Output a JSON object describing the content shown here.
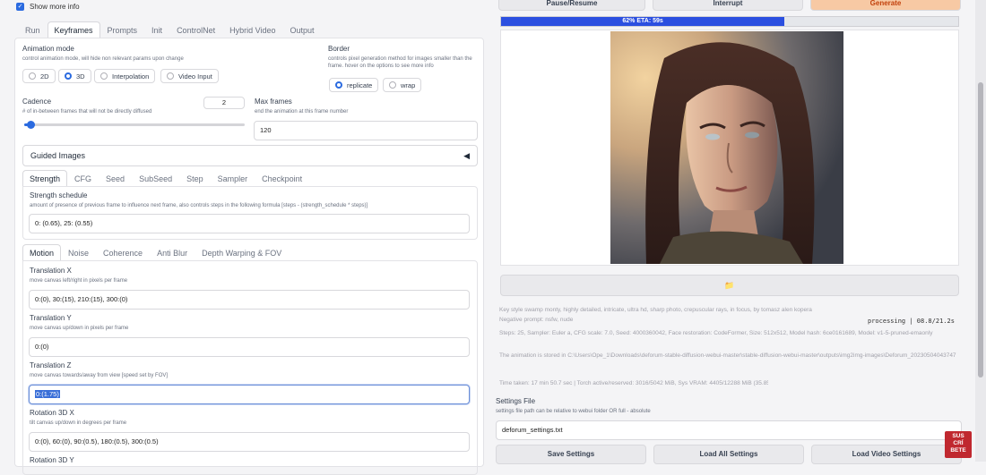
{
  "show_more_info": "Show more info",
  "main_tabs": [
    "Run",
    "Keyframes",
    "Prompts",
    "Init",
    "ControlNet",
    "Hybrid Video",
    "Output"
  ],
  "animation_mode": {
    "label": "Animation mode",
    "hint": "control animation mode, will hide non relevant params upon change",
    "options": [
      "2D",
      "3D",
      "Interpolation",
      "Video Input"
    ],
    "selected": "3D"
  },
  "border": {
    "label": "Border",
    "hint": "controls pixel generation method for images smaller than the frame. hover on the options to see more info",
    "options": [
      "replicate",
      "wrap"
    ],
    "selected": "replicate"
  },
  "cadence": {
    "label": "Cadence",
    "hint": "# of in-between frames that will not be directly diffused",
    "value": "2",
    "slider_fraction": 0.03
  },
  "max_frames": {
    "label": "Max frames",
    "hint": "end the animation at this frame number",
    "value": "120"
  },
  "guided_images": {
    "label": "Guided Images",
    "arrow": "◀"
  },
  "schedule_tabs": [
    "Strength",
    "CFG",
    "Seed",
    "SubSeed",
    "Step",
    "Sampler",
    "Checkpoint"
  ],
  "strength_schedule": {
    "label": "Strength schedule",
    "hint": "amount of presence of previous frame to influence next frame, also controls steps in the following formula [steps - (strength_schedule * steps)]",
    "value": "0: (0.65), 25: (0.55)"
  },
  "motion_tabs": [
    "Motion",
    "Noise",
    "Coherence",
    "Anti Blur",
    "Depth Warping & FOV"
  ],
  "translation_x": {
    "label": "Translation X",
    "hint": "move canvas left/right in pixels per frame",
    "value": "0:(0), 30:(15), 210:(15), 300:(0)"
  },
  "translation_y": {
    "label": "Translation Y",
    "hint": "move canvas up/down in pixels per frame",
    "value": "0:(0)"
  },
  "translation_z": {
    "label": "Translation Z",
    "hint": "move canvas towards/away from view [speed set by FOV]",
    "value": "0:(1.75)"
  },
  "rotation_3d_x": {
    "label": "Rotation 3D X",
    "hint": "tilt canvas up/down in degrees per frame",
    "value": "0:(0), 60:(0), 90:(0.5), 180:(0.5), 300:(0.5)"
  },
  "rotation_3d_y": {
    "label": "Rotation 3D Y"
  },
  "top_buttons": [
    "Pause/Resume",
    "Interrupt",
    "Generate"
  ],
  "progress": {
    "text": "62% ETA: 59s",
    "fraction": 0.62
  },
  "folder_icon": "📁",
  "info": {
    "prompt": "Key style swamp monty, highly detailed, intricate, ultra hd, sharp photo, crepuscular rays, in focus, by tomasz alen kopera",
    "negative": "Negative prompt: nsfw, nude",
    "processing": "processing | 08.8/21.2s",
    "params": "Steps: 25, Sampler: Euler a, CFG scale: 7.0, Seed: 4000360042, Face restoration: CodeFormer, Size: 512x512, Model hash: 6ce0161689, Model: v1-5-pruned-emaonly",
    "stored": "The animation is stored in C:\\Users\\Ope_1\\Downloads\\deforum-stable-diffusion-webui-master\\stable-diffusion-webui-master\\outputs\\img2img-images\\Deforum_20230504043747",
    "time": "Time taken: 17 min 50.7 sec | Torch active/reserved: 3016/5042 MiB, Sys VRAM: 4405/12288 MiB (35.85%)"
  },
  "settings_file": {
    "label": "Settings File",
    "hint": "settings file path can be relative to webui folder OR full - absolute",
    "value": "deforum_settings.txt"
  },
  "bottom_buttons": [
    "Save Settings",
    "Load All Settings",
    "Load Video Settings"
  ],
  "logo": {
    "lines": [
      "SUS",
      "CRÍ",
      "BETE"
    ]
  }
}
